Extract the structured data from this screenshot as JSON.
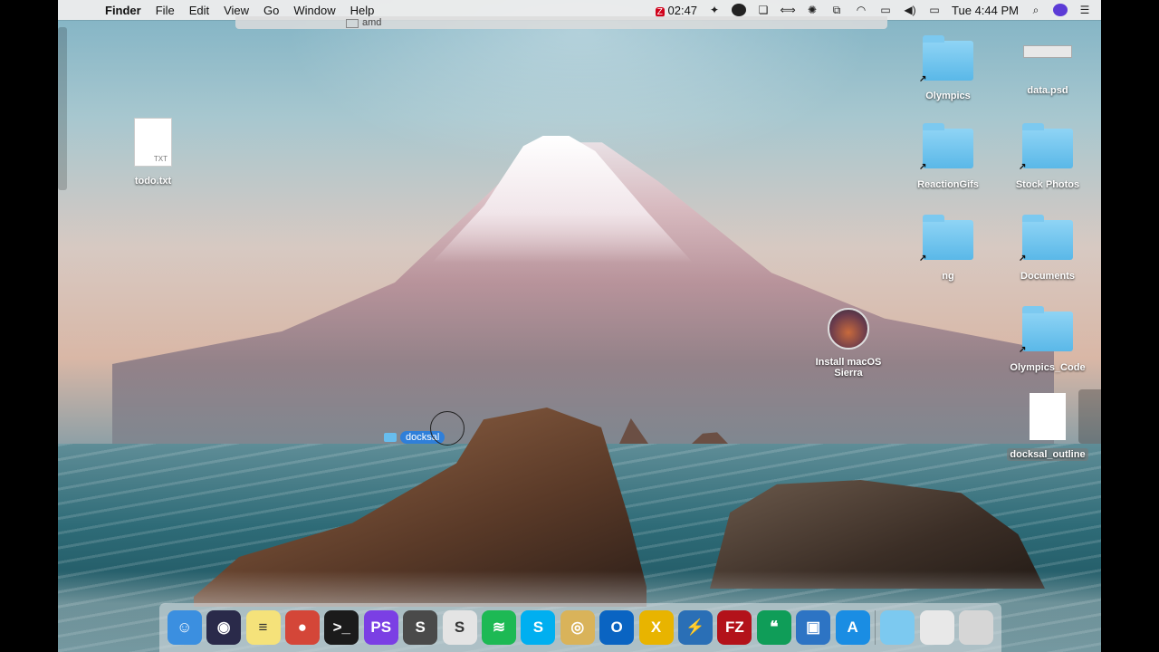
{
  "menubar": {
    "apple_icon": "apple-icon",
    "items": [
      "Finder",
      "File",
      "Edit",
      "View",
      "Go",
      "Window",
      "Help"
    ],
    "flash_badge": "Z",
    "timer": "02:47",
    "clock": "Tue 4:44 PM"
  },
  "ghost_window": {
    "title": "amd"
  },
  "desktop_icons": {
    "todo": {
      "label": "todo.txt",
      "ext": "TXT"
    },
    "olympics": {
      "label": "Olympics"
    },
    "data_psd": {
      "label": "data.psd"
    },
    "reaction_gifs": {
      "label": "ReactionGifs"
    },
    "stock_photos": {
      "label": "Stock Photos"
    },
    "ng": {
      "label": "ng"
    },
    "documents": {
      "label": "Documents"
    },
    "install_sierra": {
      "label_line1": "Install macOS",
      "label_line2": "Sierra"
    },
    "olympics_code": {
      "label": "Olympics_Code"
    },
    "docksal_outline": {
      "label": "docksal_outline"
    }
  },
  "drag_item": {
    "label": "docksal"
  },
  "dock": {
    "apps": [
      {
        "name": "finder",
        "glyph": "☺",
        "color": "#3b8fe0"
      },
      {
        "name": "siri",
        "glyph": "◉",
        "color": "#2a2a4a"
      },
      {
        "name": "notes",
        "glyph": "≡",
        "color": "#f5e27a"
      },
      {
        "name": "chrome",
        "glyph": "●",
        "color": "#d44638"
      },
      {
        "name": "terminal",
        "glyph": ">_",
        "color": "#1b1b1b"
      },
      {
        "name": "phpstorm",
        "glyph": "PS",
        "color": "#7b3fe4"
      },
      {
        "name": "sublime",
        "glyph": "S",
        "color": "#4a4a4a"
      },
      {
        "name": "slack",
        "glyph": "S",
        "color": "#e4e4e4"
      },
      {
        "name": "spotify",
        "glyph": "≋",
        "color": "#1db954"
      },
      {
        "name": "skype",
        "glyph": "S",
        "color": "#00aff0"
      },
      {
        "name": "sequel-pro",
        "glyph": "◎",
        "color": "#d9b35a"
      },
      {
        "name": "outlook",
        "glyph": "O",
        "color": "#0a64c2"
      },
      {
        "name": "xcode-x",
        "glyph": "X",
        "color": "#e8b400"
      },
      {
        "name": "transmit",
        "glyph": "⚡",
        "color": "#2a6fb6"
      },
      {
        "name": "filezilla",
        "glyph": "FZ",
        "color": "#b3121a"
      },
      {
        "name": "hangouts",
        "glyph": "❝",
        "color": "#0f9d58"
      },
      {
        "name": "vmware",
        "glyph": "▣",
        "color": "#2d74c4"
      },
      {
        "name": "app-store",
        "glyph": "A",
        "color": "#1a8de3"
      }
    ],
    "right": [
      {
        "name": "downloads-folder",
        "glyph": "",
        "color": "#7cc9f0"
      },
      {
        "name": "stack-item",
        "glyph": "",
        "color": "#e8e8e8"
      },
      {
        "name": "trash",
        "glyph": "",
        "color": "#d6d6d6"
      }
    ]
  }
}
